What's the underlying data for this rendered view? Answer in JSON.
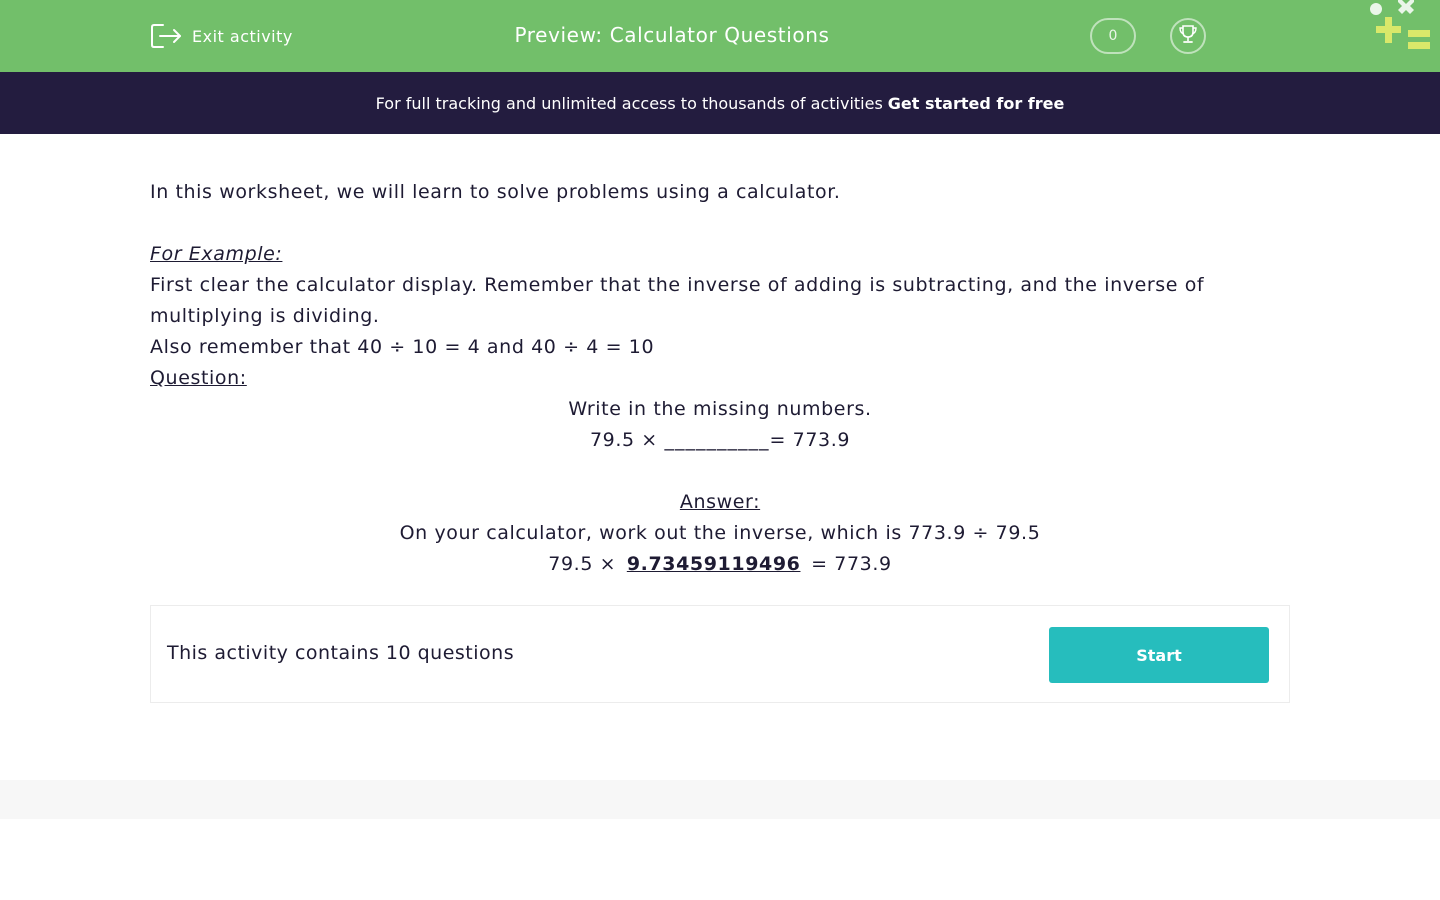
{
  "header": {
    "exit_label": "Exit activity",
    "title": "Preview: Calculator Questions",
    "score": "0",
    "bg_color": "#72bf6a"
  },
  "banner": {
    "text": "For full tracking and unlimited access to thousands of activities",
    "cta": "Get started for free",
    "bg_color": "#231c3f"
  },
  "content": {
    "intro": "In this worksheet, we will learn to solve problems using a calculator.",
    "example_heading": "For Example:",
    "example_line1": "First clear the calculator display. Remember that the inverse of adding is subtracting, and the inverse of multiplying is dividing.",
    "example_line2": "Also remember that 40 ÷ 10 = 4 and 40 ÷ 4 = 10",
    "question_heading": "Question:",
    "question_text": "Write in the missing numbers.",
    "question_left": "79.5 ×",
    "question_blank": "__________",
    "question_right": "= 773.9",
    "answer_heading": "Answer:",
    "answer_text": "On your calculator, work out the inverse, which is 773.9 ÷ 79.5",
    "answer_left": "79.5 ×",
    "answer_value": "9.73459119496",
    "answer_right": "= 773.9"
  },
  "activity_card": {
    "text": "This activity contains 10 questions",
    "start_label": "Start",
    "button_color": "#26bdbd"
  },
  "icons": [
    "exit-icon",
    "trophy-icon",
    "brand-logo"
  ]
}
